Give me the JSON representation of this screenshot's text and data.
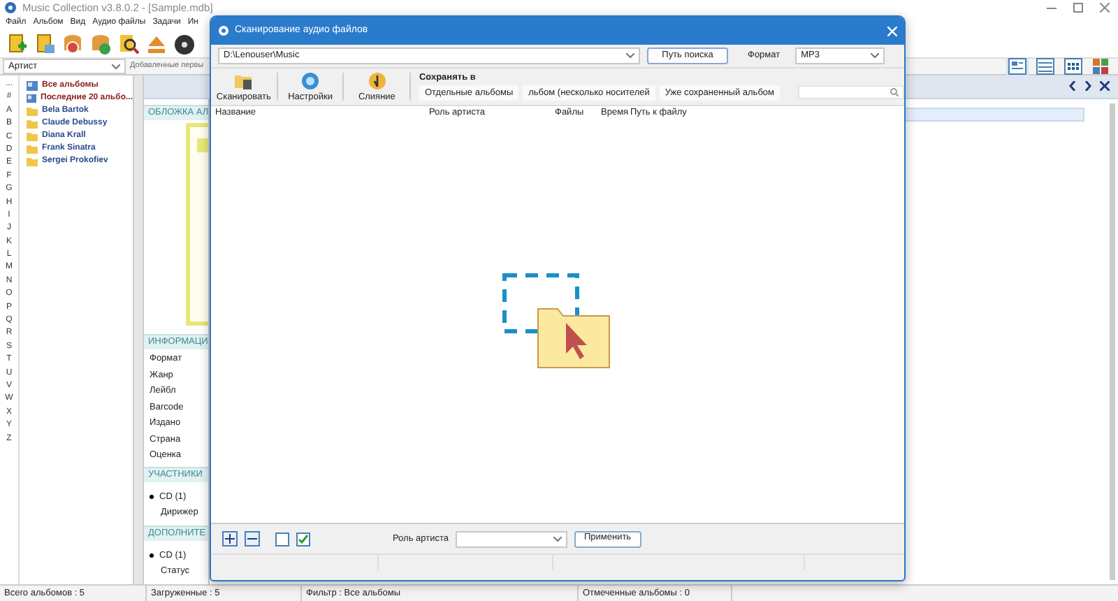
{
  "app": {
    "title": "Music Collection v3.8.0.2 - [Sample.mdb]",
    "menu": [
      "Файл",
      "Альбом",
      "Вид",
      "Аудио файлы",
      "Задачи",
      "Ин"
    ],
    "group_by": "Артист",
    "sort": "Добавленные первы",
    "letters": [
      "...",
      "#",
      "A",
      "B",
      "C",
      "D",
      "E",
      "F",
      "G",
      "H",
      "I",
      "J",
      "K",
      "L",
      "M",
      "N",
      "O",
      "P",
      "Q",
      "R",
      "S",
      "T",
      "U",
      "V",
      "W",
      "X",
      "Y",
      "Z"
    ],
    "tree": [
      {
        "label": "Все альбомы",
        "kind": "special"
      },
      {
        "label": "Последние 20 альбо...",
        "kind": "special"
      },
      {
        "label": "Bela Bartok",
        "kind": "artist"
      },
      {
        "label": "Claude Debussy",
        "kind": "artist"
      },
      {
        "label": "Diana Krall",
        "kind": "artist"
      },
      {
        "label": "Frank Sinatra",
        "kind": "artist"
      },
      {
        "label": "Sergei Prokofiev",
        "kind": "artist"
      }
    ],
    "view_modes": [
      {
        "kind": "details",
        "selected": true
      },
      {
        "kind": "list",
        "selected": false
      },
      {
        "kind": "grid",
        "selected": false
      },
      {
        "kind": "tiles",
        "selected": false
      }
    ],
    "sections": [
      {
        "title": "ОБЛОЖКА АЛ",
        "kind": "cover"
      },
      {
        "title": "ИНФОРМАЦИ",
        "kind": "fields",
        "rows": [
          "Формат",
          "Жанр",
          "Лейбл",
          "Barcode",
          "Издано",
          "Страна",
          "Оценка"
        ]
      },
      {
        "title": "УЧАСТНИКИ",
        "kind": "media",
        "disc": "CD (1)",
        "label": "Дирижер"
      },
      {
        "title": "ДОПОЛНИТЕ",
        "kind": "media",
        "disc": "CD (1)",
        "label": "Статус"
      }
    ],
    "status_bar": [
      "Всего альбомов : 5",
      "Загруженные : 5",
      "Фильтр : Все альбомы",
      "Отмеченные альбомы : 0"
    ]
  },
  "dialog": {
    "title": "Сканирование аудио файлов",
    "path": "D:\\Lenouser\\Music",
    "browse_button": "Путь поиска",
    "format_label": "Формат",
    "format": "MP3",
    "tools": [
      {
        "label": "Сканировать",
        "kind": "scan"
      },
      {
        "label": "Настройки",
        "kind": "settings"
      },
      {
        "label": "Слияние",
        "kind": "merge"
      }
    ],
    "save_to": {
      "label": "Сохранять в",
      "options": [
        "Отдельные альбомы",
        "льбом (несколько носителей",
        "Уже сохраненный альбом"
      ]
    },
    "columns": [
      "Название",
      "Роль артиста",
      "Файлы",
      "Время",
      "Путь к файлу"
    ],
    "role_label": "Роль артиста",
    "apply_button": "Применить"
  }
}
